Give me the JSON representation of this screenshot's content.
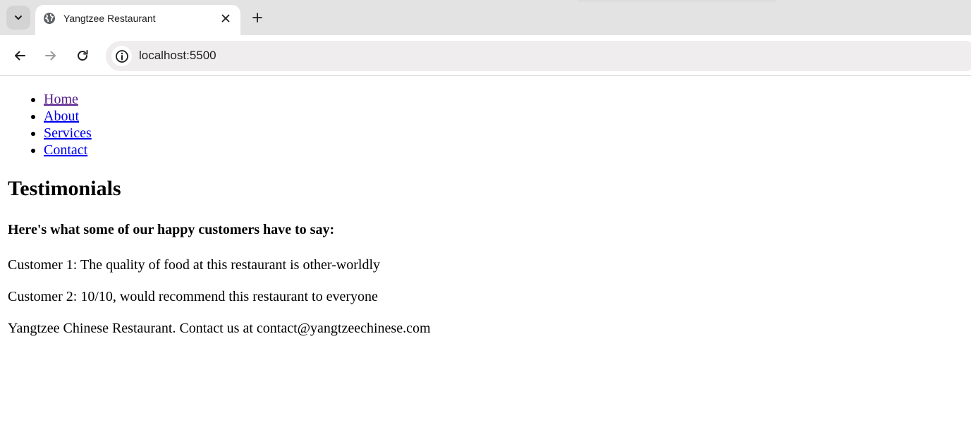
{
  "browser": {
    "tab_title": "Yangtzee Restaurant",
    "url": "localhost:5500",
    "icons": {
      "tab_search": "chevron-down-icon",
      "favicon": "globe-icon",
      "close_tab": "close-icon",
      "new_tab": "plus-icon",
      "back": "arrow-left-icon",
      "forward": "arrow-right-icon",
      "reload": "reload-icon",
      "site_info": "info-icon"
    }
  },
  "page": {
    "nav": [
      {
        "label": "Home"
      },
      {
        "label": "About"
      },
      {
        "label": "Services"
      },
      {
        "label": "Contact"
      }
    ],
    "heading": "Testimonials",
    "subheading": "Here's what some of our happy customers have to say:",
    "testimonials": [
      "Customer 1: The quality of food at this restaurant is other-worldly",
      "Customer 2: 10/10, would recommend this restaurant to everyone"
    ],
    "footer": "Yangtzee Chinese Restaurant. Contact us at contact@yangtzeechinese.com"
  },
  "colors": {
    "link": "#0000ee",
    "visited_link": "#551a8b",
    "tabstrip_bg": "#e3e3e3",
    "omnibox_bg": "#efeded"
  }
}
